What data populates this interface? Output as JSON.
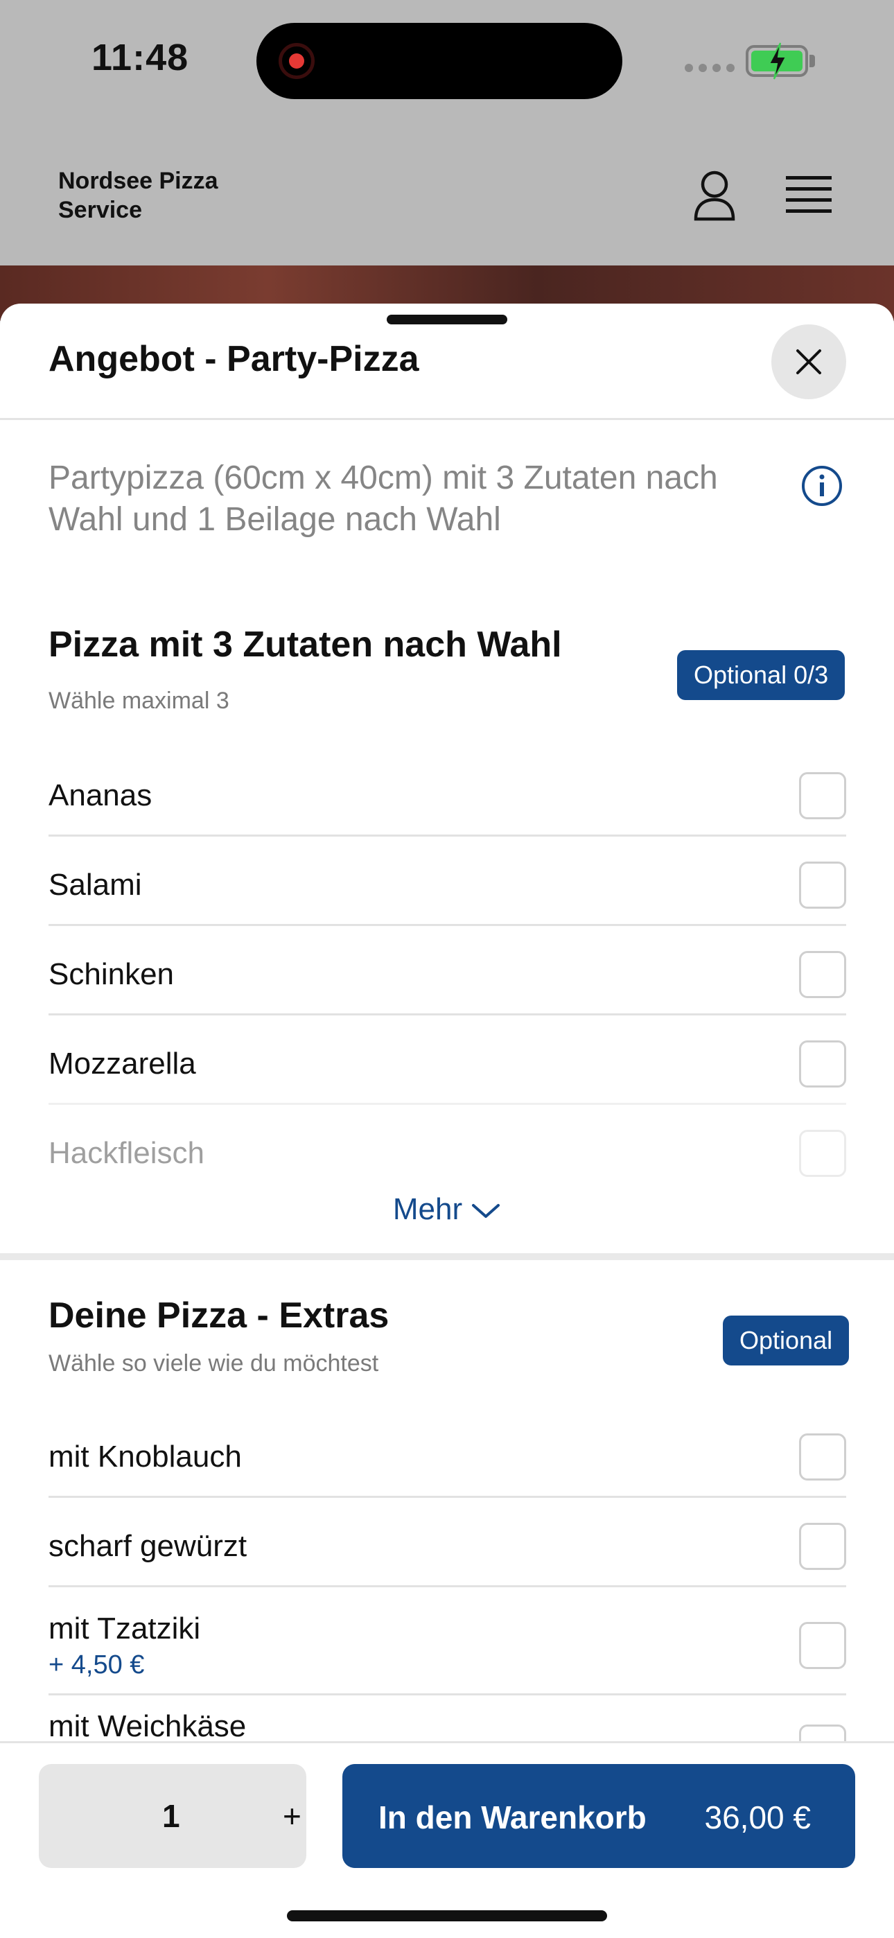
{
  "status_bar": {
    "time": "11:48"
  },
  "header": {
    "brand": "Nordsee Pizza Service"
  },
  "sheet": {
    "title": "Angebot - Party-Pizza",
    "description": "Partypizza (60cm x 40cm) mit 3 Zutaten nach Wahl und 1 Beilage nach Wahl"
  },
  "group1": {
    "title": "Pizza mit 3 Zutaten nach Wahl",
    "subtitle": "Wähle maximal 3",
    "badge": "Optional 0/3",
    "options": [
      {
        "label": "Ananas"
      },
      {
        "label": "Salami"
      },
      {
        "label": "Schinken"
      },
      {
        "label": "Mozzarella"
      },
      {
        "label": "Hackfleisch"
      }
    ],
    "more_label": "Mehr"
  },
  "group2": {
    "title": "Deine Pizza - Extras",
    "subtitle": "Wähle so viele wie du möchtest",
    "badge": "Optional",
    "options": [
      {
        "label": "mit Knoblauch"
      },
      {
        "label": "scharf gewürzt"
      },
      {
        "label": "mit Tzatziki",
        "price": "+ 4,50 €"
      },
      {
        "label": "mit Weichkäse"
      }
    ]
  },
  "bottom_bar": {
    "quantity": "1",
    "plus": "+",
    "cart_label": "In den Warenkorb",
    "cart_price": "36,00 €"
  },
  "colors": {
    "accent": "#144a8c",
    "dim_bg": "#b9b9b9",
    "battery": "#3fcc54",
    "record": "#e53935"
  }
}
